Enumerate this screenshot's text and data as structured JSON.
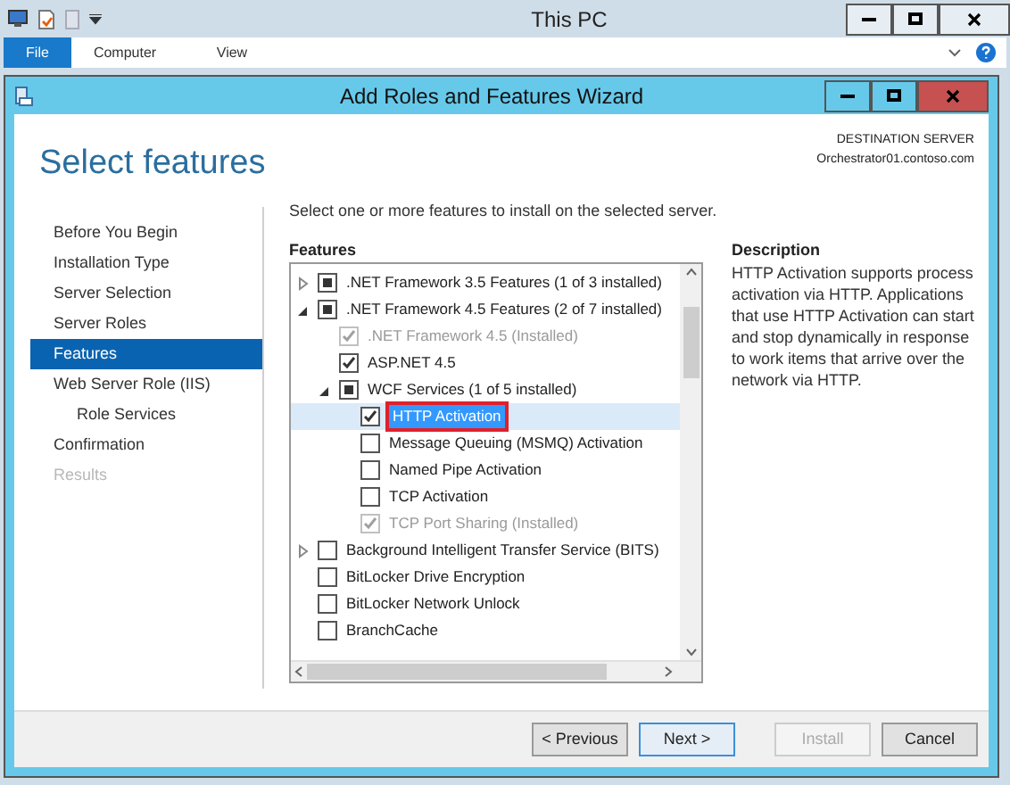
{
  "explorer": {
    "title": "This PC",
    "ribbon_tabs": [
      {
        "label": "File",
        "selected": true
      },
      {
        "label": "Computer",
        "selected": false
      },
      {
        "label": "View",
        "selected": false
      }
    ]
  },
  "wizard": {
    "title": "Add Roles and Features Wizard",
    "page_title": "Select features",
    "destination": {
      "label": "DESTINATION SERVER",
      "server": "Orchestrator01.contoso.com"
    },
    "steps": [
      {
        "label": "Before You Begin",
        "selected": false,
        "disabled": false
      },
      {
        "label": "Installation Type",
        "selected": false,
        "disabled": false
      },
      {
        "label": "Server Selection",
        "selected": false,
        "disabled": false
      },
      {
        "label": "Server Roles",
        "selected": false,
        "disabled": false
      },
      {
        "label": "Features",
        "selected": true,
        "disabled": false
      },
      {
        "label": "Web Server Role (IIS)",
        "selected": false,
        "disabled": false,
        "children": [
          {
            "label": "Role Services",
            "selected": false,
            "disabled": false
          }
        ]
      },
      {
        "label": "Confirmation",
        "selected": false,
        "disabled": false
      },
      {
        "label": "Results",
        "selected": false,
        "disabled": true
      }
    ],
    "instruction": "Select one or more features to install on the selected server.",
    "features_label": "Features",
    "features": [
      {
        "label": ".NET Framework 3.5 Features (1 of 3 installed)",
        "checked": false,
        "indeterminate": true,
        "expanded": false,
        "disabled": false,
        "selected": false
      },
      {
        "label": ".NET Framework 4.5 Features (2 of 7 installed)",
        "checked": false,
        "indeterminate": true,
        "expanded": true,
        "disabled": false,
        "selected": false,
        "children": [
          {
            "label": ".NET Framework 4.5 (Installed)",
            "checked": true,
            "indeterminate": false,
            "disabled": true,
            "selected": false
          },
          {
            "label": "ASP.NET 4.5",
            "checked": true,
            "indeterminate": false,
            "disabled": false,
            "selected": false
          },
          {
            "label": "WCF Services (1 of 5 installed)",
            "checked": false,
            "indeterminate": true,
            "expanded": true,
            "disabled": false,
            "selected": false,
            "children": [
              {
                "label": "HTTP Activation",
                "checked": true,
                "indeterminate": false,
                "disabled": false,
                "selected": true
              },
              {
                "label": "Message Queuing (MSMQ) Activation",
                "checked": false,
                "indeterminate": false,
                "disabled": false,
                "selected": false
              },
              {
                "label": "Named Pipe Activation",
                "checked": false,
                "indeterminate": false,
                "disabled": false,
                "selected": false
              },
              {
                "label": "TCP Activation",
                "checked": false,
                "indeterminate": false,
                "disabled": false,
                "selected": false
              },
              {
                "label": "TCP Port Sharing (Installed)",
                "checked": true,
                "indeterminate": false,
                "disabled": true,
                "selected": false
              }
            ]
          }
        ]
      },
      {
        "label": "Background Intelligent Transfer Service (BITS)",
        "checked": false,
        "indeterminate": false,
        "expanded": false,
        "disabled": false,
        "selected": false
      },
      {
        "label": "BitLocker Drive Encryption",
        "checked": false,
        "indeterminate": false,
        "disabled": false,
        "selected": false
      },
      {
        "label": "BitLocker Network Unlock",
        "checked": false,
        "indeterminate": false,
        "disabled": false,
        "selected": false
      },
      {
        "label": "BranchCache",
        "checked": false,
        "indeterminate": false,
        "disabled": false,
        "selected": false
      }
    ],
    "description_label": "Description",
    "description": "HTTP Activation supports process activation via HTTP. Applications that use HTTP Activation can start and stop dynamically in response to work items that arrive over the network via HTTP.",
    "buttons": [
      {
        "label": "< Previous",
        "disabled": false,
        "selected": false
      },
      {
        "label": "Next >",
        "disabled": false,
        "selected": true
      },
      {
        "label": "Install",
        "disabled": true,
        "selected": false
      },
      {
        "label": "Cancel",
        "disabled": false,
        "selected": false
      }
    ]
  }
}
